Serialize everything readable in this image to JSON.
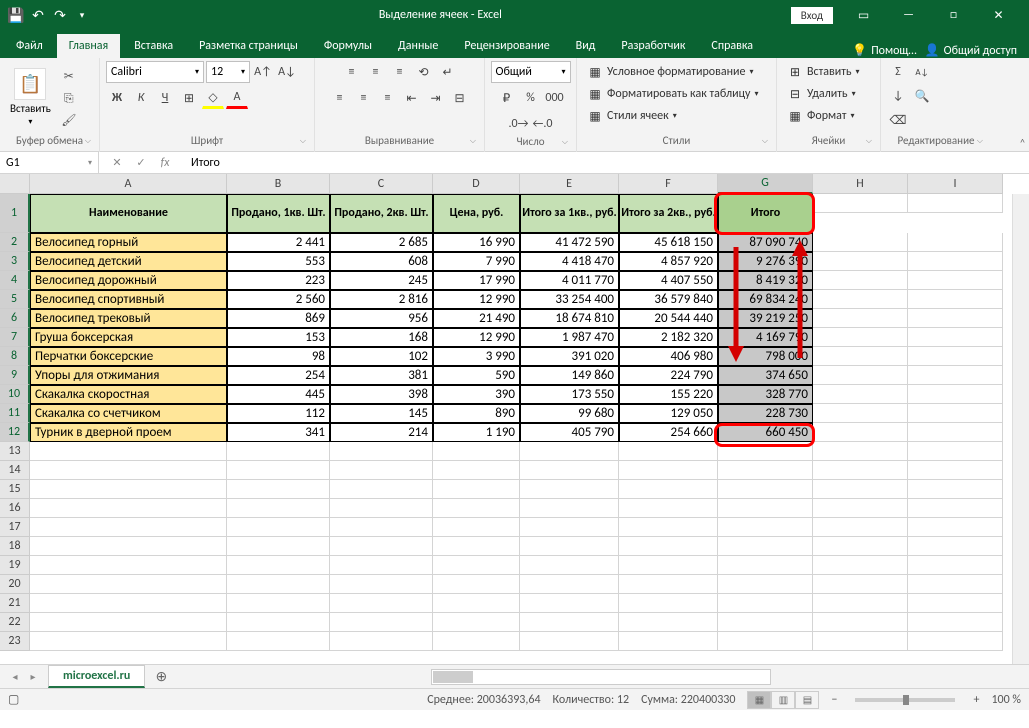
{
  "title": "Выделение ячеек  -  Excel",
  "signin": "Вход",
  "tabs": [
    "Файл",
    "Главная",
    "Вставка",
    "Разметка страницы",
    "Формулы",
    "Данные",
    "Рецензирование",
    "Вид",
    "Разработчик",
    "Справка"
  ],
  "help": "Помощ…",
  "share": "Общий доступ",
  "ribbon": {
    "clipboard": {
      "paste": "Вставить",
      "label": "Буфер обмена"
    },
    "font": {
      "name": "Calibri",
      "size": "12",
      "label": "Шрифт"
    },
    "align": {
      "label": "Выравнивание"
    },
    "number": {
      "format": "Общий",
      "label": "Число"
    },
    "styles": {
      "cond": "Условное форматирование",
      "table": "Форматировать как таблицу",
      "cell": "Стили ячеек",
      "label": "Стили"
    },
    "cells": {
      "insert": "Вставить",
      "delete": "Удалить",
      "format": "Формат",
      "label": "Ячейки"
    },
    "edit": {
      "label": "Редактирование"
    }
  },
  "namebox": "G1",
  "formula": "Итого",
  "cols": [
    "A",
    "B",
    "C",
    "D",
    "E",
    "F",
    "G",
    "H",
    "I"
  ],
  "headers": [
    "Наименование",
    "Продано, 1кв. Шт.",
    "Продано, 2кв. Шт.",
    "Цена, руб.",
    "Итого за 1кв., руб.",
    "Итого за 2кв., руб.",
    "Итого"
  ],
  "rows": [
    {
      "name": "Велосипед горный",
      "q1": "2 441",
      "q2": "2 685",
      "price": "16 990",
      "t1": "41 472 590",
      "t2": "45 618 150",
      "total": "87 090 740"
    },
    {
      "name": "Велосипед детский",
      "q1": "553",
      "q2": "608",
      "price": "7 990",
      "t1": "4 418 470",
      "t2": "4 857 920",
      "total": "9 276 390"
    },
    {
      "name": "Велосипед дорожный",
      "q1": "223",
      "q2": "245",
      "price": "17 990",
      "t1": "4 011 770",
      "t2": "4 407 550",
      "total": "8 419 320"
    },
    {
      "name": "Велосипед спортивный",
      "q1": "2 560",
      "q2": "2 816",
      "price": "12 990",
      "t1": "33 254 400",
      "t2": "36 579 840",
      "total": "69 834 240"
    },
    {
      "name": "Велосипед трековый",
      "q1": "869",
      "q2": "956",
      "price": "21 490",
      "t1": "18 674 810",
      "t2": "20 544 440",
      "total": "39 219 250"
    },
    {
      "name": "Груша боксерская",
      "q1": "153",
      "q2": "168",
      "price": "12 990",
      "t1": "1 987 470",
      "t2": "2 182 320",
      "total": "4 169 790"
    },
    {
      "name": "Перчатки боксерские",
      "q1": "98",
      "q2": "102",
      "price": "3 990",
      "t1": "391 020",
      "t2": "406 980",
      "total": "798 000"
    },
    {
      "name": "Упоры для отжимания",
      "q1": "254",
      "q2": "381",
      "price": "590",
      "t1": "149 860",
      "t2": "224 790",
      "total": "374 650"
    },
    {
      "name": "Скакалка скоростная",
      "q1": "445",
      "q2": "398",
      "price": "390",
      "t1": "173 550",
      "t2": "155 220",
      "total": "328 770"
    },
    {
      "name": "Скакалка со счетчиком",
      "q1": "112",
      "q2": "145",
      "price": "890",
      "t1": "99 680",
      "t2": "129 050",
      "total": "228 730"
    },
    {
      "name": "Турник в дверной проем",
      "q1": "341",
      "q2": "214",
      "price": "1 190",
      "t1": "405 790",
      "t2": "254 660",
      "total": "660 450"
    }
  ],
  "sheet": "microexcel.ru",
  "status": {
    "avg": "Среднее: 20036393,64",
    "count": "Количество: 12",
    "sum": "Сумма: 220400330",
    "zoom": "100 %"
  }
}
